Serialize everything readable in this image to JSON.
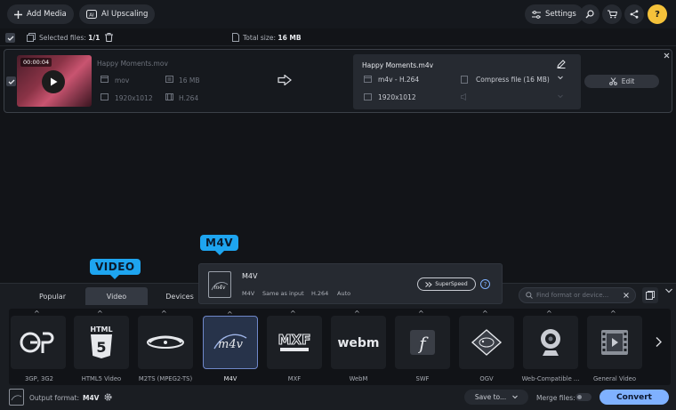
{
  "toolbar": {
    "add_media": "Add Media",
    "ai_upscaling": "AI Upscaling",
    "settings": "Settings",
    "help": "?"
  },
  "selection": {
    "selected_label": "Selected files:",
    "selected_value": "1/1",
    "total_label": "Total size:",
    "total_value": "16 MB"
  },
  "file": {
    "duration": "00:00:04",
    "name": "Happy Moments.mov",
    "format": "mov",
    "size": "16 MB",
    "resolution": "1920x1012",
    "codec": "H.264"
  },
  "output": {
    "name": "Happy Moments.m4v",
    "format": "m4v - H.264",
    "compress": "Compress file (16 MB)",
    "resolution": "1920x1012",
    "edit": "Edit"
  },
  "callouts": {
    "video": "VIDEO",
    "m4v": "M4V"
  },
  "popup": {
    "title": "M4V",
    "details": [
      "M4V",
      "Same as input",
      "H.264",
      "Auto"
    ],
    "superspeed": "SuperSpeed",
    "info": "?"
  },
  "tabs": [
    "Popular",
    "Video",
    "Devices"
  ],
  "search": {
    "placeholder": "Find format or device..."
  },
  "formats": [
    {
      "label": "3GP, 3G2"
    },
    {
      "label": "HTML5 Video"
    },
    {
      "label": "M2TS (MPEG2-TS)"
    },
    {
      "label": "M4V"
    },
    {
      "label": "MXF"
    },
    {
      "label": "WebM"
    },
    {
      "label": "SWF"
    },
    {
      "label": "OGV"
    },
    {
      "label": "Web-Compatible ..."
    },
    {
      "label": "General Video"
    }
  ],
  "format_logos": {
    "html5": "HTML",
    "html5_num": "5",
    "m4v": "m4v",
    "mxf": "MXF",
    "webm": "webm",
    "swf": "f"
  },
  "bottom": {
    "output_label": "Output format:",
    "output_value": "M4V",
    "save_to": "Save to...",
    "merge": "Merge files:",
    "convert": "Convert"
  },
  "colors": {
    "accent": "#7fb1ff",
    "callout": "#1ea5f0",
    "help": "#f5c23a"
  }
}
